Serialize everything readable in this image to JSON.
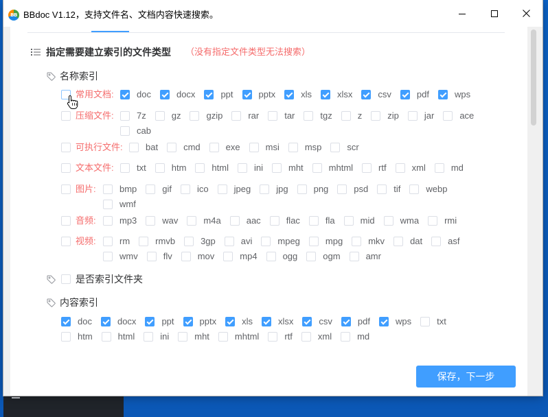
{
  "window": {
    "logo_text": "BB",
    "title": "BBdoc V1.12，支持文件名、文档内容快速搜索。",
    "controls": [
      "minimize-icon",
      "maximize-icon",
      "close-icon"
    ]
  },
  "section": {
    "icon": "list-icon",
    "title": "指定需要建立索引的文件类型",
    "hint": "（没有指定文件类型无法搜索）"
  },
  "name_index": {
    "icon": "tag-icon",
    "label": "名称索引",
    "groups": [
      {
        "label": "常用文档:",
        "checked": false,
        "items": [
          {
            "label": "doc",
            "checked": true
          },
          {
            "label": "docx",
            "checked": true
          },
          {
            "label": "ppt",
            "checked": true
          },
          {
            "label": "pptx",
            "checked": true
          },
          {
            "label": "xls",
            "checked": true
          },
          {
            "label": "xlsx",
            "checked": true
          },
          {
            "label": "csv",
            "checked": true
          },
          {
            "label": "pdf",
            "checked": true
          },
          {
            "label": "wps",
            "checked": true
          }
        ]
      },
      {
        "label": "压缩文件:",
        "checked": false,
        "items": [
          {
            "label": "7z",
            "checked": false
          },
          {
            "label": "gz",
            "checked": false
          },
          {
            "label": "gzip",
            "checked": false
          },
          {
            "label": "rar",
            "checked": false
          },
          {
            "label": "tar",
            "checked": false
          },
          {
            "label": "tgz",
            "checked": false
          },
          {
            "label": "z",
            "checked": false
          },
          {
            "label": "zip",
            "checked": false
          },
          {
            "label": "jar",
            "checked": false
          },
          {
            "label": "ace",
            "checked": false
          },
          {
            "label": "cab",
            "checked": false
          }
        ]
      },
      {
        "label": "可执行文件:",
        "checked": false,
        "items": [
          {
            "label": "bat",
            "checked": false
          },
          {
            "label": "cmd",
            "checked": false
          },
          {
            "label": "exe",
            "checked": false
          },
          {
            "label": "msi",
            "checked": false
          },
          {
            "label": "msp",
            "checked": false
          },
          {
            "label": "scr",
            "checked": false
          }
        ]
      },
      {
        "label": "文本文件:",
        "checked": false,
        "items": [
          {
            "label": "txt",
            "checked": false
          },
          {
            "label": "htm",
            "checked": false
          },
          {
            "label": "html",
            "checked": false
          },
          {
            "label": "ini",
            "checked": false
          },
          {
            "label": "mht",
            "checked": false
          },
          {
            "label": "mhtml",
            "checked": false
          },
          {
            "label": "rtf",
            "checked": false
          },
          {
            "label": "xml",
            "checked": false
          },
          {
            "label": "md",
            "checked": false
          }
        ]
      },
      {
        "label": "图片:",
        "checked": false,
        "items": [
          {
            "label": "bmp",
            "checked": false
          },
          {
            "label": "gif",
            "checked": false
          },
          {
            "label": "ico",
            "checked": false
          },
          {
            "label": "jpeg",
            "checked": false
          },
          {
            "label": "jpg",
            "checked": false
          },
          {
            "label": "png",
            "checked": false
          },
          {
            "label": "psd",
            "checked": false
          },
          {
            "label": "tif",
            "checked": false
          },
          {
            "label": "webp",
            "checked": false
          },
          {
            "label": "wmf",
            "checked": false
          }
        ]
      },
      {
        "label": "音频:",
        "checked": false,
        "items": [
          {
            "label": "mp3",
            "checked": false
          },
          {
            "label": "wav",
            "checked": false
          },
          {
            "label": "m4a",
            "checked": false
          },
          {
            "label": "aac",
            "checked": false
          },
          {
            "label": "flac",
            "checked": false
          },
          {
            "label": "fla",
            "checked": false
          },
          {
            "label": "mid",
            "checked": false
          },
          {
            "label": "wma",
            "checked": false
          },
          {
            "label": "rmi",
            "checked": false
          }
        ]
      },
      {
        "label": "视频:",
        "checked": false,
        "items": [
          {
            "label": "rm",
            "checked": false
          },
          {
            "label": "rmvb",
            "checked": false
          },
          {
            "label": "3gp",
            "checked": false
          },
          {
            "label": "avi",
            "checked": false
          },
          {
            "label": "mpeg",
            "checked": false
          },
          {
            "label": "mpg",
            "checked": false
          },
          {
            "label": "mkv",
            "checked": false
          },
          {
            "label": "dat",
            "checked": false
          },
          {
            "label": "asf",
            "checked": false
          },
          {
            "label": "wmv",
            "checked": false
          },
          {
            "label": "flv",
            "checked": false
          },
          {
            "label": "mov",
            "checked": false
          },
          {
            "label": "mp4",
            "checked": false
          },
          {
            "label": "ogg",
            "checked": false
          },
          {
            "label": "ogm",
            "checked": false
          },
          {
            "label": "amr",
            "checked": false
          }
        ]
      }
    ]
  },
  "folder_index": {
    "icon": "tag-icon",
    "label": "是否索引文件夹",
    "checked": false
  },
  "content_index": {
    "icon": "tag-icon",
    "label": "内容索引",
    "items": [
      {
        "label": "doc",
        "checked": true
      },
      {
        "label": "docx",
        "checked": true
      },
      {
        "label": "ppt",
        "checked": true
      },
      {
        "label": "pptx",
        "checked": true
      },
      {
        "label": "xls",
        "checked": true
      },
      {
        "label": "xlsx",
        "checked": true
      },
      {
        "label": "csv",
        "checked": true
      },
      {
        "label": "pdf",
        "checked": true
      },
      {
        "label": "wps",
        "checked": true
      },
      {
        "label": "txt",
        "checked": false
      },
      {
        "label": "htm",
        "checked": false
      },
      {
        "label": "html",
        "checked": false
      },
      {
        "label": "ini",
        "checked": false
      },
      {
        "label": "mht",
        "checked": false
      },
      {
        "label": "mhtml",
        "checked": false
      },
      {
        "label": "rtf",
        "checked": false
      },
      {
        "label": "xml",
        "checked": false
      },
      {
        "label": "md",
        "checked": false
      }
    ]
  },
  "footer": {
    "save_button": "保存，下一步"
  },
  "cursor": "hand-pointer-icon",
  "colors": {
    "primary": "#409eff",
    "danger": "#f56c6c",
    "label": "#606266"
  }
}
